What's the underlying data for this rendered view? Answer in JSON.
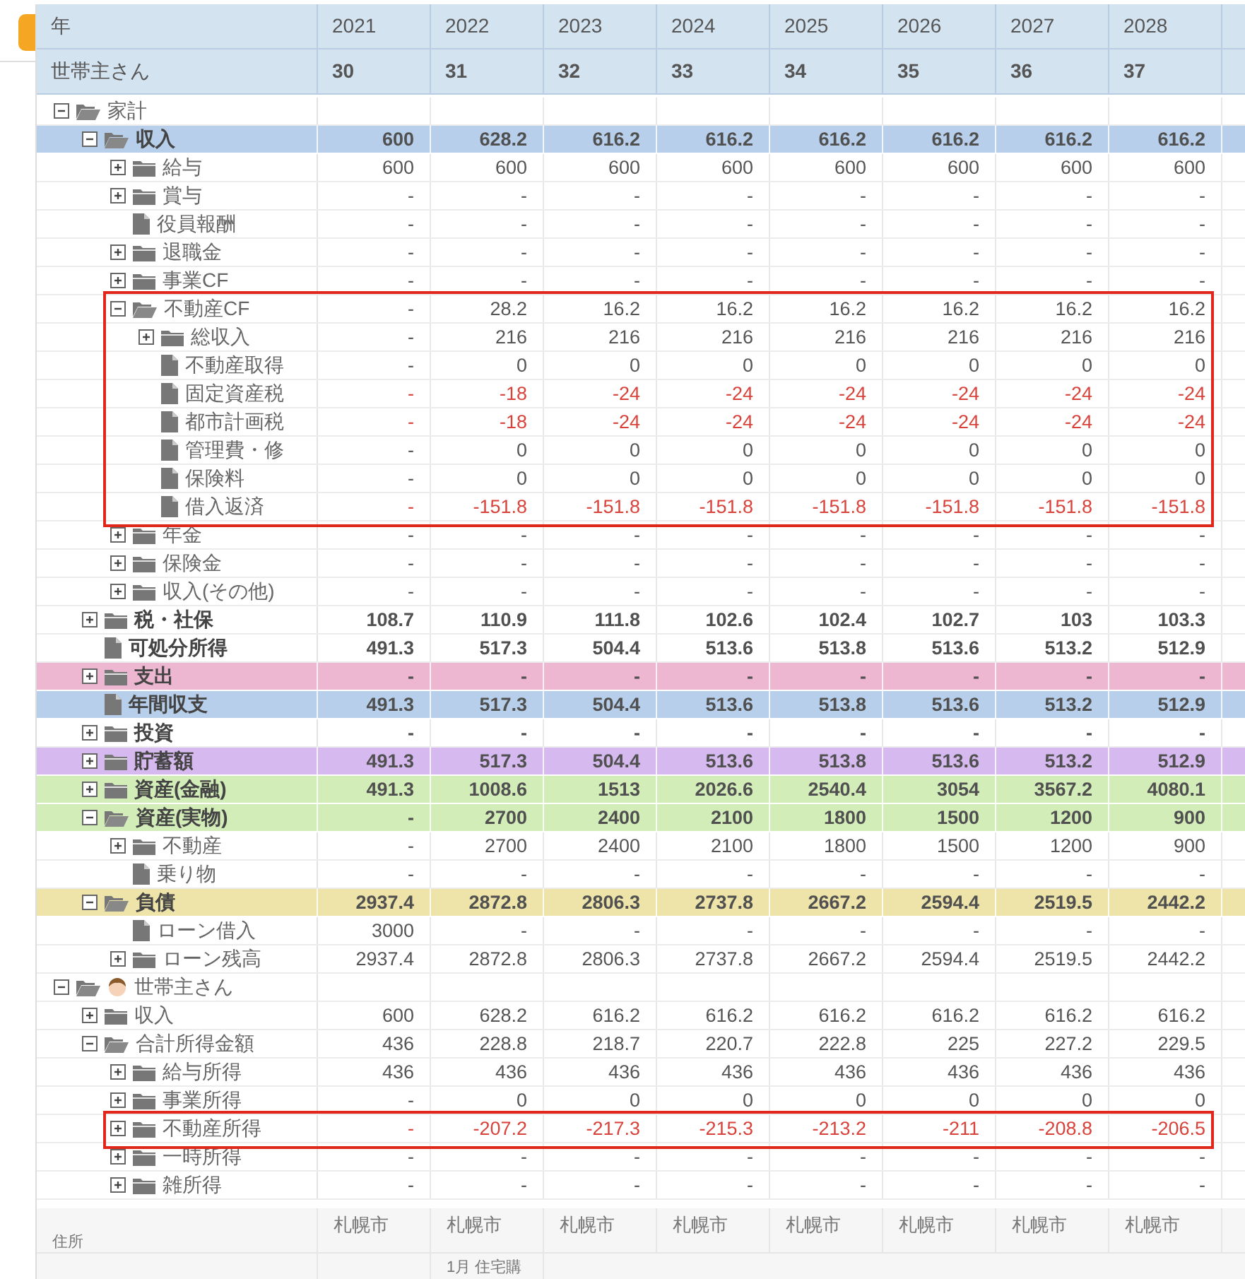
{
  "header": {
    "year_label": "年",
    "age_label": "世帯主さん",
    "columns": [
      {
        "year": "2021",
        "age": "30"
      },
      {
        "year": "2022",
        "age": "31"
      },
      {
        "year": "2023",
        "age": "32"
      },
      {
        "year": "2024",
        "age": "33"
      },
      {
        "year": "2025",
        "age": "34"
      },
      {
        "year": "2026",
        "age": "35"
      },
      {
        "year": "2027",
        "age": "36"
      },
      {
        "year": "2028",
        "age": "37"
      }
    ]
  },
  "tree": [
    {
      "label": "家計",
      "kind": "folder",
      "expanded": true,
      "children": [
        {
          "label": "収入",
          "kind": "folder",
          "expanded": true,
          "bold": true,
          "color": "#b7cfea",
          "values": [
            "600",
            "628.2",
            "616.2",
            "616.2",
            "616.2",
            "616.2",
            "616.2",
            "616.2"
          ],
          "children": [
            {
              "label": "給与",
              "kind": "folder",
              "expanded": false,
              "values": [
                "600",
                "600",
                "600",
                "600",
                "600",
                "600",
                "600",
                "600"
              ]
            },
            {
              "label": "賞与",
              "kind": "folder",
              "expanded": false,
              "values": [
                "-",
                "-",
                "-",
                "-",
                "-",
                "-",
                "-",
                "-"
              ]
            },
            {
              "label": "役員報酬",
              "kind": "file",
              "values": [
                "-",
                "-",
                "-",
                "-",
                "-",
                "-",
                "-",
                "-"
              ]
            },
            {
              "label": "退職金",
              "kind": "folder",
              "expanded": false,
              "values": [
                "-",
                "-",
                "-",
                "-",
                "-",
                "-",
                "-",
                "-"
              ]
            },
            {
              "label": "事業CF",
              "kind": "folder",
              "expanded": false,
              "values": [
                "-",
                "-",
                "-",
                "-",
                "-",
                "-",
                "-",
                "-"
              ]
            },
            {
              "label": "不動産CF",
              "kind": "folder",
              "expanded": true,
              "highlighted": true,
              "values": [
                "-",
                "28.2",
                "16.2",
                "16.2",
                "16.2",
                "16.2",
                "16.2",
                "16.2"
              ],
              "children": [
                {
                  "label": "総収入",
                  "kind": "folder",
                  "expanded": false,
                  "values": [
                    "-",
                    "216",
                    "216",
                    "216",
                    "216",
                    "216",
                    "216",
                    "216"
                  ]
                },
                {
                  "label": "不動産取得",
                  "kind": "file",
                  "values": [
                    "-",
                    "0",
                    "0",
                    "0",
                    "0",
                    "0",
                    "0",
                    "0"
                  ]
                },
                {
                  "label": "固定資産税",
                  "kind": "file",
                  "negative": true,
                  "values": [
                    "-",
                    "-18",
                    "-24",
                    "-24",
                    "-24",
                    "-24",
                    "-24",
                    "-24"
                  ]
                },
                {
                  "label": "都市計画税",
                  "kind": "file",
                  "negative": true,
                  "values": [
                    "-",
                    "-18",
                    "-24",
                    "-24",
                    "-24",
                    "-24",
                    "-24",
                    "-24"
                  ]
                },
                {
                  "label": "管理費・修",
                  "kind": "file",
                  "values": [
                    "-",
                    "0",
                    "0",
                    "0",
                    "0",
                    "0",
                    "0",
                    "0"
                  ]
                },
                {
                  "label": "保険料",
                  "kind": "file",
                  "values": [
                    "-",
                    "0",
                    "0",
                    "0",
                    "0",
                    "0",
                    "0",
                    "0"
                  ]
                },
                {
                  "label": "借入返済",
                  "kind": "file",
                  "negative": true,
                  "values": [
                    "-",
                    "-151.8",
                    "-151.8",
                    "-151.8",
                    "-151.8",
                    "-151.8",
                    "-151.8",
                    "-151.8"
                  ]
                }
              ]
            },
            {
              "label": "年金",
              "kind": "folder",
              "expanded": false,
              "values": [
                "-",
                "-",
                "-",
                "-",
                "-",
                "-",
                "-",
                "-"
              ]
            },
            {
              "label": "保険金",
              "kind": "folder",
              "expanded": false,
              "values": [
                "-",
                "-",
                "-",
                "-",
                "-",
                "-",
                "-",
                "-"
              ]
            },
            {
              "label": "収入(その他)",
              "kind": "folder",
              "expanded": false,
              "values": [
                "-",
                "-",
                "-",
                "-",
                "-",
                "-",
                "-",
                "-"
              ]
            }
          ]
        },
        {
          "label": "税・社保",
          "kind": "folder",
          "expanded": false,
          "bold": true,
          "values": [
            "108.7",
            "110.9",
            "111.8",
            "102.6",
            "102.4",
            "102.7",
            "103",
            "103.3"
          ]
        },
        {
          "label": "可処分所得",
          "kind": "file",
          "bold": true,
          "values": [
            "491.3",
            "517.3",
            "504.4",
            "513.6",
            "513.8",
            "513.6",
            "513.2",
            "512.9"
          ]
        },
        {
          "label": "支出",
          "kind": "folder",
          "expanded": false,
          "bold": true,
          "color": "#edb6d1",
          "values": [
            "-",
            "-",
            "-",
            "-",
            "-",
            "-",
            "-",
            "-"
          ]
        },
        {
          "label": "年間収支",
          "kind": "file",
          "bold": true,
          "color": "#b7cfea",
          "values": [
            "491.3",
            "517.3",
            "504.4",
            "513.6",
            "513.8",
            "513.6",
            "513.2",
            "512.9"
          ]
        },
        {
          "label": "投資",
          "kind": "folder",
          "expanded": false,
          "bold": true,
          "values": [
            "-",
            "-",
            "-",
            "-",
            "-",
            "-",
            "-",
            "-"
          ]
        },
        {
          "label": "貯蓄額",
          "kind": "folder",
          "expanded": false,
          "bold": true,
          "color": "#d6b9ee",
          "values": [
            "491.3",
            "517.3",
            "504.4",
            "513.6",
            "513.8",
            "513.6",
            "513.2",
            "512.9"
          ]
        },
        {
          "label": "資産(金融)",
          "kind": "folder",
          "expanded": false,
          "bold": true,
          "color": "#d3edb9",
          "values": [
            "491.3",
            "1008.6",
            "1513",
            "2026.6",
            "2540.4",
            "3054",
            "3567.2",
            "4080.1"
          ]
        },
        {
          "label": "資産(実物)",
          "kind": "folder",
          "expanded": true,
          "bold": true,
          "color": "#d3edb9",
          "values": [
            "-",
            "2700",
            "2400",
            "2100",
            "1800",
            "1500",
            "1200",
            "900"
          ],
          "children": [
            {
              "label": "不動産",
              "kind": "folder",
              "expanded": false,
              "values": [
                "-",
                "2700",
                "2400",
                "2100",
                "1800",
                "1500",
                "1200",
                "900"
              ]
            },
            {
              "label": "乗り物",
              "kind": "file",
              "values": [
                "-",
                "-",
                "-",
                "-",
                "-",
                "-",
                "-",
                "-"
              ]
            }
          ]
        },
        {
          "label": "負債",
          "kind": "folder",
          "expanded": true,
          "bold": true,
          "color": "#eee4a9",
          "values": [
            "2937.4",
            "2872.8",
            "2806.3",
            "2737.8",
            "2667.2",
            "2594.4",
            "2519.5",
            "2442.2"
          ],
          "children": [
            {
              "label": "ローン借入",
              "kind": "file",
              "values": [
                "3000",
                "-",
                "-",
                "-",
                "-",
                "-",
                "-",
                "-"
              ]
            },
            {
              "label": "ローン残高",
              "kind": "folder",
              "expanded": false,
              "values": [
                "2937.4",
                "2872.8",
                "2806.3",
                "2737.8",
                "2667.2",
                "2594.4",
                "2519.5",
                "2442.2"
              ]
            }
          ]
        }
      ]
    },
    {
      "label": "世帯主さん",
      "kind": "folder",
      "expanded": true,
      "avatar": true,
      "children": [
        {
          "label": "収入",
          "kind": "folder",
          "expanded": false,
          "values": [
            "600",
            "628.2",
            "616.2",
            "616.2",
            "616.2",
            "616.2",
            "616.2",
            "616.2"
          ]
        },
        {
          "label": "合計所得金額",
          "kind": "folder",
          "expanded": true,
          "values": [
            "436",
            "228.8",
            "218.7",
            "220.7",
            "222.8",
            "225",
            "227.2",
            "229.5"
          ],
          "children": [
            {
              "label": "給与所得",
              "kind": "folder",
              "expanded": false,
              "values": [
                "436",
                "436",
                "436",
                "436",
                "436",
                "436",
                "436",
                "436"
              ]
            },
            {
              "label": "事業所得",
              "kind": "folder",
              "expanded": false,
              "values": [
                "-",
                "0",
                "0",
                "0",
                "0",
                "0",
                "0",
                "0"
              ]
            },
            {
              "label": "不動産所得",
              "kind": "folder",
              "expanded": false,
              "highlighted": true,
              "negative": true,
              "values": [
                "-",
                "-207.2",
                "-217.3",
                "-215.3",
                "-213.2",
                "-211",
                "-208.8",
                "-206.5"
              ]
            },
            {
              "label": "一時所得",
              "kind": "folder",
              "expanded": false,
              "values": [
                "-",
                "-",
                "-",
                "-",
                "-",
                "-",
                "-",
                "-"
              ]
            },
            {
              "label": "雑所得",
              "kind": "folder",
              "expanded": false,
              "values": [
                "-",
                "-",
                "-",
                "-",
                "-",
                "-",
                "-",
                "-"
              ]
            }
          ]
        }
      ]
    }
  ],
  "footer": [
    {
      "label": "住所",
      "cells": [
        {
          "kind": "text",
          "text": "札幌市"
        },
        {
          "kind": "text",
          "text": "札幌市"
        },
        {
          "kind": "text",
          "text": "札幌市"
        },
        {
          "kind": "text",
          "text": "札幌市"
        },
        {
          "kind": "text",
          "text": "札幌市"
        },
        {
          "kind": "text",
          "text": "札幌市"
        },
        {
          "kind": "text",
          "text": "札幌市"
        },
        {
          "kind": "text",
          "text": "札幌市"
        }
      ]
    },
    {
      "cells": [
        {
          "kind": "blank"
        },
        {
          "kind": "text",
          "text": "1月 住宅購"
        }
      ]
    }
  ]
}
